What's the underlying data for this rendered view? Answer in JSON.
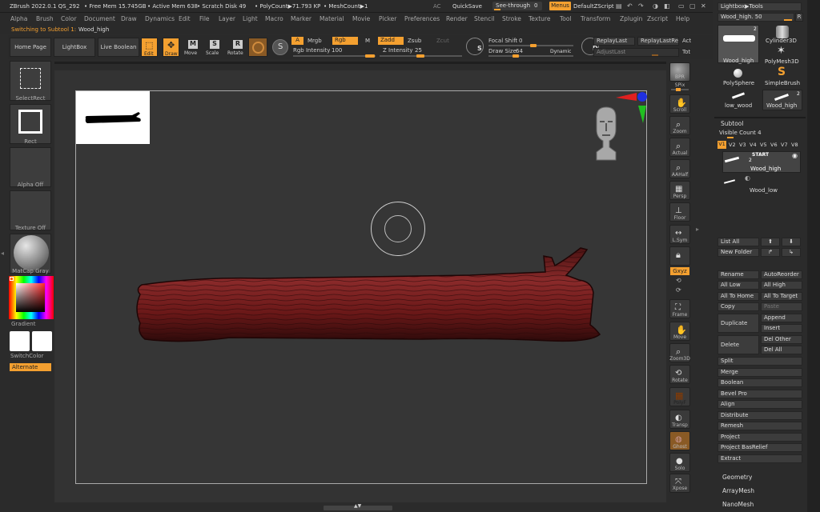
{
  "titlebar": {
    "app": "ZBrush 2022.0.1 QS_292",
    "free_mem": "• Free Mem 15.745GB",
    "active_mem": "• Active Mem 638",
    "scratch": "• Scratch Disk 49",
    "polycount": "• PolyCount▶71.793 KP",
    "meshcount": "• MeshCount▶1",
    "ac": "AC",
    "quicksave": "QuickSave",
    "see_through": "See-through",
    "see_through_val": "0",
    "menus": "Menus",
    "default_zscript": "DefaultZScript"
  },
  "menubar": [
    "Alpha",
    "Brush",
    "Color",
    "Document",
    "Draw",
    "Dynamics",
    "Edit",
    "File",
    "Layer",
    "Light",
    "Macro",
    "Marker",
    "Material",
    "Movie",
    "Picker",
    "Preferences",
    "Render",
    "Stencil",
    "Stroke",
    "Texture",
    "Tool",
    "Transform",
    "Zplugin",
    "Zscript",
    "Help"
  ],
  "info": {
    "status": "Switching to Subtool 1:",
    "subtool": "Wood_high"
  },
  "toolbar": {
    "home_page": "Home Page",
    "lightbox": "LightBox",
    "live_boolean": "Live Boolean",
    "edit": "Edit",
    "draw": "Draw",
    "move": "Move",
    "scale": "Scale",
    "rotate": "Rotate",
    "a": "A",
    "mrgb": "Mrgb",
    "rgb": "Rgb",
    "m": "M",
    "zadd": "Zadd",
    "zsub": "Zsub",
    "zcut": "Zcut",
    "rgb_intensity": "Rgb Intensity",
    "rgb_intensity_val": "100",
    "z_intensity": "Z Intensity",
    "z_intensity_val": "25",
    "focal_shift": "Focal Shift",
    "focal_shift_val": "0",
    "draw_size": "Draw Size",
    "draw_size_val": "64",
    "dynamic": "Dynamic",
    "replay_last": "ReplayLast",
    "replay_last_rel": "ReplayLastRel",
    "act": "Act",
    "adjust_last": "AdjustLast",
    "tot": "Tot",
    "s": "S",
    "d": "D"
  },
  "leftpanel": {
    "select_rect": "SelectRect",
    "rect": "Rect",
    "alpha_off": "Alpha Off",
    "texture_off": "Texture Off",
    "matcap": "MatCap Gray",
    "gradient": "Gradient",
    "switch_color": "SwitchColor",
    "alternate": "Alternate"
  },
  "viewport": {
    "bpr": "BPR",
    "spix": "SPix",
    "scroll": "Scroll",
    "zoom": "Zoom",
    "actual": "Actual",
    "aahalf": "AAHalf",
    "persp": "Persp",
    "floor": "Floor",
    "lsym": "L.Sym",
    "xyz": "Gxyz",
    "frame": "Frame",
    "move": "Move",
    "zoom3d": "Zoom3D",
    "rotate": "Rotate",
    "polyf": "PolyF",
    "transp": "Transp",
    "ghost": "Ghost",
    "solo": "Solo",
    "xpose": "Xpose"
  },
  "rightpanel": {
    "lightbox_tools": "Lightbox▶Tools",
    "wood_high_slider": "Wood_high. 50",
    "r": "R",
    "tools": [
      {
        "name": "Wood_high",
        "badge": "2"
      },
      {
        "name": "Cylinder3D"
      },
      {
        "name": "PolyMesh3D"
      },
      {
        "name": "PolySphere"
      },
      {
        "name": "SimpleBrush"
      },
      {
        "name": "low_wood"
      },
      {
        "name": "Wood_high",
        "badge": "2"
      }
    ],
    "subtool": "Subtool",
    "visible_count": "Visible Count 4",
    "vtabs": [
      "V1",
      "V2",
      "V3",
      "V4",
      "V5",
      "V6",
      "V7",
      "V8"
    ],
    "start": "START",
    "st1": "Wood_high",
    "st1_badge": "2",
    "st2": "Wood_low",
    "list_all": "List All",
    "new_folder": "New Folder",
    "rename": "Rename",
    "autoreorder": "AutoReorder",
    "all_low": "All Low",
    "all_high": "All High",
    "all_to_home": "All To Home",
    "all_to_target": "All To Target",
    "copy": "Copy",
    "paste": "Paste",
    "duplicate": "Duplicate",
    "append": "Append",
    "insert": "Insert",
    "delete": "Delete",
    "del_other": "Del Other",
    "del_all": "Del All",
    "actions": [
      "Split",
      "Merge",
      "Boolean",
      "Bevel Pro",
      "Align",
      "Distribute",
      "Remesh",
      "Project",
      "Project BasRelief",
      "Extract"
    ],
    "sections": [
      "Geometry",
      "ArrayMesh",
      "NanoMesh"
    ]
  }
}
